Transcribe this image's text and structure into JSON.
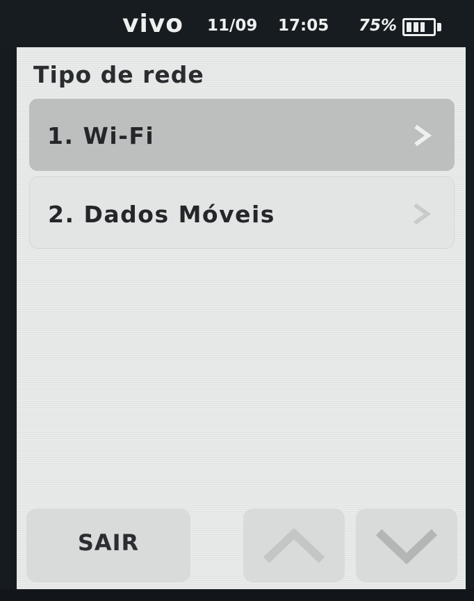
{
  "status_bar": {
    "carrier": "vivo",
    "date": "11/09",
    "time": "17:05",
    "battery_percent": "75%",
    "battery_level": 0.75,
    "battery_icon": "battery-icon"
  },
  "screen": {
    "title": "Tipo de rede",
    "menu_items": [
      {
        "label": "1. Wi-Fi",
        "selected": true,
        "icon": "chevron-right-icon"
      },
      {
        "label": "2. Dados Móveis",
        "selected": false,
        "icon": "chevron-right-icon"
      }
    ]
  },
  "soft_keys": {
    "exit_label": "SAIR",
    "up_icon": "chevron-up-icon",
    "down_icon": "chevron-down-icon"
  },
  "colors": {
    "selected_item_bg": "#bdbfbe",
    "screen_bg": "#e9ebea",
    "bezel": "#161b1f"
  }
}
